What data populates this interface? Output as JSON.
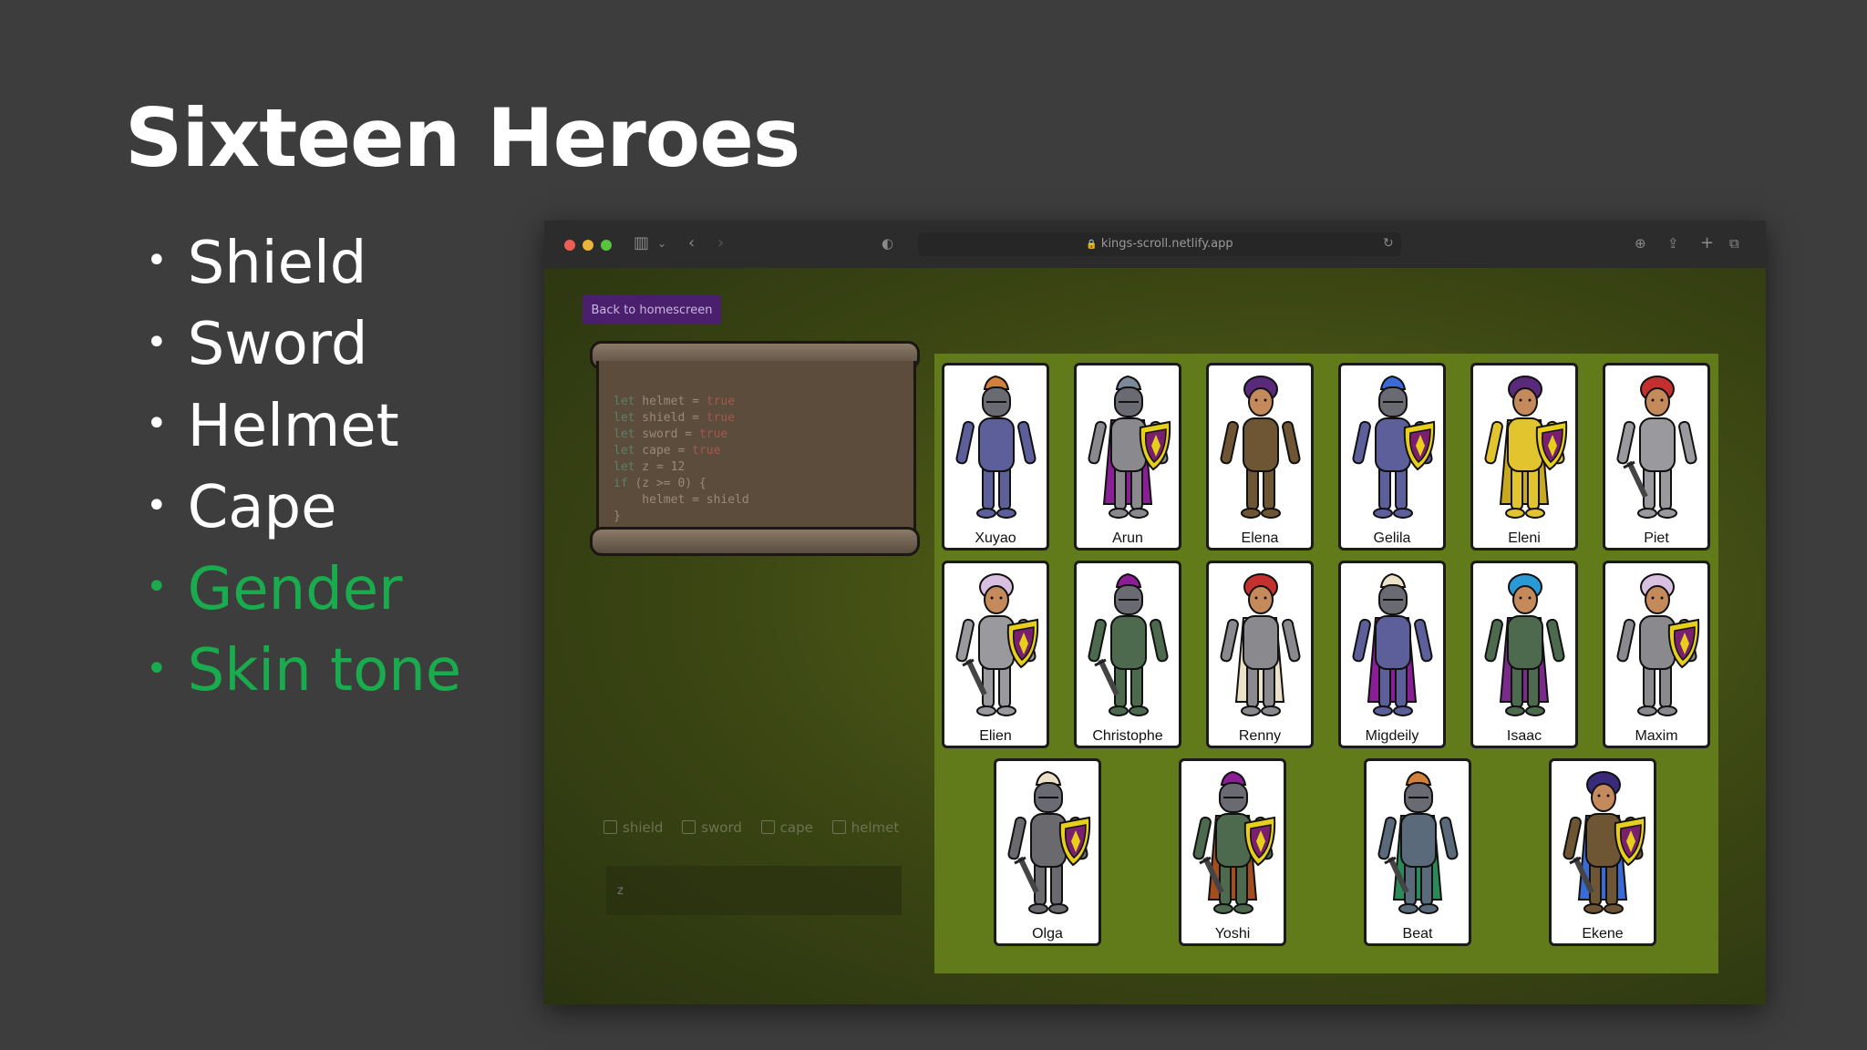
{
  "slide": {
    "title": "Sixteen Heroes",
    "bullets": [
      {
        "text": "Shield",
        "highlight": false
      },
      {
        "text": "Sword",
        "highlight": false
      },
      {
        "text": "Helmet",
        "highlight": false
      },
      {
        "text": "Cape",
        "highlight": false
      },
      {
        "text": "Gender",
        "highlight": true
      },
      {
        "text": "Skin tone",
        "highlight": true
      }
    ],
    "bullet_char": "•",
    "highlight_color": "#1aab4e"
  },
  "browser": {
    "url": "kings-scroll.netlify.app",
    "lock_icon": "🔒",
    "icons": [
      "sidebar-icon",
      "chevron-down-icon",
      "back-icon",
      "forward-icon",
      "shield-icon",
      "reload-icon",
      "download-icon",
      "share-icon",
      "new-tab-icon",
      "tabs-icon"
    ]
  },
  "app": {
    "back_button": "Back to homescreen",
    "code_lines": [
      [
        "let",
        " helmet = ",
        "true"
      ],
      [
        "let",
        " shield = ",
        "true"
      ],
      [
        "let",
        " sword = ",
        "true"
      ],
      [
        "let",
        " cape = ",
        "true"
      ],
      [
        "let",
        " z = 12",
        ""
      ],
      [
        "if",
        " (z >= 0) {",
        ""
      ],
      [
        "",
        "    helmet = shield",
        ""
      ],
      [
        "",
        "}",
        ""
      ]
    ],
    "checkbox_labels": {
      "shield": "shield",
      "sword": "sword",
      "cape": "cape",
      "helmet": "helmet"
    },
    "z_placeholder": "z",
    "heroes": [
      {
        "name": "Xuyao",
        "body": "#5c5f9a",
        "hair": "#d2803a",
        "helmet": true,
        "cape": null,
        "shield": false,
        "sword": false
      },
      {
        "name": "Arun",
        "body": "#8a8a8e",
        "hair": "#7a8a99",
        "helmet": true,
        "cape": "#8a1e94",
        "shield": true,
        "sword": false
      },
      {
        "name": "Elena",
        "body": "#6e5534",
        "hair": "#5a2a7a",
        "helmet": false,
        "cape": null,
        "shield": false,
        "sword": false
      },
      {
        "name": "Gelila",
        "body": "#5c5f9a",
        "hair": "#3a6ad6",
        "helmet": true,
        "cape": null,
        "shield": true,
        "sword": false
      },
      {
        "name": "Eleni",
        "body": "#e2c42e",
        "hair": "#5a2a7a",
        "helmet": false,
        "cape": "#c8a81e",
        "shield": true,
        "sword": false
      },
      {
        "name": "Piet",
        "body": "#9a9a9e",
        "hair": "#c43030",
        "helmet": false,
        "cape": null,
        "shield": false,
        "sword": true
      },
      {
        "name": "Elien",
        "body": "#9a9a9e",
        "hair": "#d8c0e0",
        "helmet": false,
        "cape": null,
        "shield": true,
        "sword": true
      },
      {
        "name": "Christophe",
        "body": "#4d6a4e",
        "hair": "#8a1e94",
        "helmet": true,
        "cape": null,
        "shield": false,
        "sword": true
      },
      {
        "name": "Renny",
        "body": "#8a8a8e",
        "hair": "#c43030",
        "helmet": false,
        "cape": "#ece2c8",
        "shield": false,
        "sword": false
      },
      {
        "name": "Migdeily",
        "body": "#5c5f9a",
        "hair": "#ece2c8",
        "helmet": true,
        "cape": "#8a1e94",
        "shield": false,
        "sword": false
      },
      {
        "name": "Isaac",
        "body": "#4d6a4e",
        "hair": "#2a9ad6",
        "helmet": false,
        "cape": "#7a2a8a",
        "shield": false,
        "sword": false
      },
      {
        "name": "Maxim",
        "body": "#8a8a8e",
        "hair": "#d8c0e0",
        "helmet": false,
        "cape": null,
        "shield": true,
        "sword": false
      },
      {
        "name": "Olga",
        "body": "#6a6a6e",
        "hair": "#ece2c8",
        "helmet": true,
        "cape": null,
        "shield": true,
        "sword": true
      },
      {
        "name": "Yoshi",
        "body": "#4d6a4e",
        "hair": "#8a1e94",
        "helmet": true,
        "cape": "#a44e1e",
        "shield": true,
        "sword": true
      },
      {
        "name": "Beat",
        "body": "#5a6a7a",
        "hair": "#d2803a",
        "helmet": true,
        "cape": "#2a8a5a",
        "shield": false,
        "sword": true
      },
      {
        "name": "Ekene",
        "body": "#6e5534",
        "hair": "#3a2a7a",
        "helmet": false,
        "cape": "#3a6ad6",
        "shield": true,
        "sword": true
      }
    ]
  }
}
